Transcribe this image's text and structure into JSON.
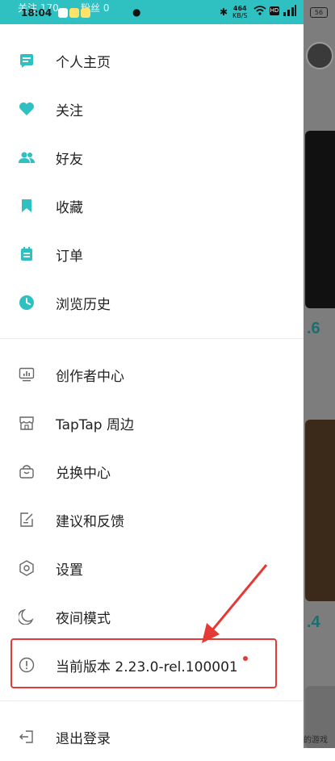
{
  "status_bar": {
    "time": "18:04",
    "overlay_follow": "关注 170",
    "overlay_fans": "粉丝 0",
    "network_speed": "464",
    "network_unit": "KB/S",
    "battery": "56"
  },
  "menu_primary": [
    {
      "label": "个人主页",
      "icon": "profile-card-icon"
    },
    {
      "label": "关注",
      "icon": "heart-icon"
    },
    {
      "label": "好友",
      "icon": "friends-icon"
    },
    {
      "label": "收藏",
      "icon": "bookmark-icon"
    },
    {
      "label": "订单",
      "icon": "order-icon"
    },
    {
      "label": "浏览历史",
      "icon": "clock-icon"
    }
  ],
  "menu_secondary": [
    {
      "label": "创作者中心",
      "icon": "creator-chart-icon"
    },
    {
      "label": "TapTap 周边",
      "icon": "store-icon"
    },
    {
      "label": "兑换中心",
      "icon": "redeem-bag-icon"
    },
    {
      "label": "建议和反馈",
      "icon": "feedback-edit-icon"
    },
    {
      "label": "设置",
      "icon": "settings-hex-icon"
    },
    {
      "label": "夜间模式",
      "icon": "moon-icon"
    },
    {
      "label": "当前版本 2.23.0-rel.100001",
      "icon": "info-circle-icon"
    }
  ],
  "logout": {
    "label": "退出登录",
    "icon": "logout-icon"
  },
  "background_app": {
    "rating_1": ".6",
    "rating_2": ".4",
    "side_text": "的游戏"
  },
  "colors": {
    "accent": "#2fc0c2",
    "annotation": "#e53935"
  }
}
